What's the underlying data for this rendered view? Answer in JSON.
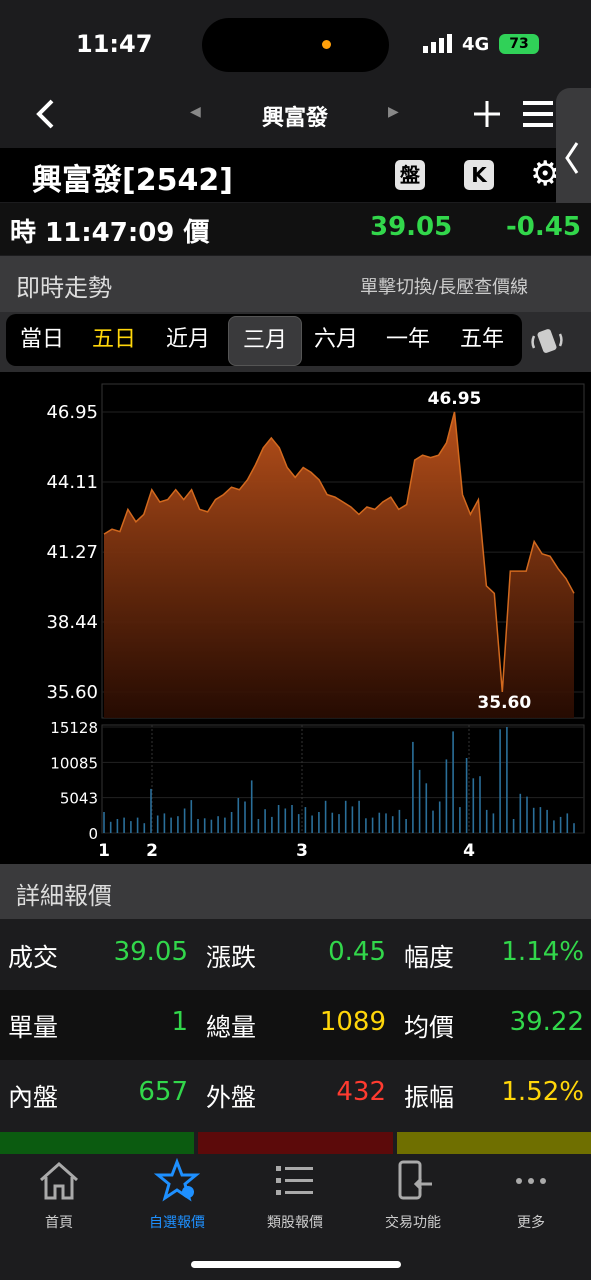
{
  "status_bar": {
    "time": "11:47",
    "network": "4G",
    "battery": "73",
    "colors": {
      "dot": "#ff9f0a",
      "battery": "#30d158"
    }
  },
  "nav": {
    "title": "興富發",
    "prev_icon": "triangle-left-icon",
    "next_icon": "triangle-right-icon",
    "back_icon": "chevron-left-icon",
    "plus_icon": "plus-icon",
    "menu_icon": "hamburger-icon",
    "side_icon": "chevron-left-icon"
  },
  "stock": {
    "title": "興富發[2542]",
    "pan_label": "盤",
    "k_label": "K",
    "gear_icon": "gear-icon"
  },
  "quote": {
    "time_label": "時 11:47:09 價",
    "price": "39.05",
    "change": "-0.45",
    "colors": {
      "up": "#32d74b"
    }
  },
  "trend": {
    "title": "即時走勢",
    "hint": "單擊切換/長壓查價線",
    "periods": [
      "當日",
      "五日",
      "近月",
      "三月",
      "六月",
      "一年",
      "五年"
    ],
    "active_period": "三月",
    "highlight_period": "五日"
  },
  "chart_data": [
    {
      "type": "area",
      "y_ticks": [
        "46.95",
        "44.11",
        "41.27",
        "38.44",
        "35.60"
      ],
      "ylim": [
        35.6,
        46.95
      ],
      "high_label": "46.95",
      "low_label": "35.60",
      "values": [
        42.0,
        42.2,
        42.1,
        43.0,
        42.5,
        42.8,
        43.8,
        43.3,
        43.4,
        43.8,
        43.4,
        43.8,
        43.0,
        42.9,
        43.4,
        43.6,
        43.9,
        43.8,
        44.2,
        44.8,
        45.5,
        45.9,
        45.5,
        44.7,
        44.3,
        44.7,
        44.5,
        44.2,
        43.6,
        43.5,
        43.3,
        43.1,
        42.8,
        43.1,
        43.0,
        43.3,
        43.5,
        43.0,
        43.2,
        45.0,
        45.2,
        45.1,
        45.2,
        45.7,
        46.95,
        43.6,
        42.8,
        43.4,
        39.9,
        39.6,
        35.6,
        40.5,
        40.5,
        40.5,
        41.7,
        41.2,
        41.1,
        40.6,
        40.2,
        39.6
      ]
    },
    {
      "type": "bar",
      "y_ticks": [
        "15128",
        "10085",
        "5043",
        "0"
      ],
      "ylim": [
        0,
        15128
      ],
      "x_labels": [
        "1",
        "2",
        "3",
        "4"
      ],
      "values": [
        3000,
        1600,
        2000,
        2200,
        1700,
        2200,
        1400,
        6300,
        2500,
        2800,
        2200,
        2400,
        3500,
        4700,
        2000,
        2100,
        1900,
        2400,
        2200,
        3000,
        5000,
        4500,
        7500,
        2000,
        3400,
        2300,
        4000,
        3500,
        4000,
        2700,
        3700,
        2500,
        3000,
        4600,
        2900,
        2700,
        4600,
        3800,
        4600,
        2100,
        2200,
        2900,
        2800,
        2400,
        3300,
        2000,
        13000,
        9000,
        7100,
        3200,
        4500,
        10500,
        14500,
        3700,
        10700,
        7800,
        8100,
        3300,
        2800,
        14800,
        15128,
        2000,
        5600,
        5200,
        3600,
        3700,
        3300,
        1800,
        2300,
        2800,
        1400
      ]
    }
  ],
  "details": {
    "title": "詳細報價",
    "rows": [
      [
        {
          "label": "成交",
          "value": "39.05",
          "color": "#32d74b"
        },
        {
          "label": "漲跌",
          "value": "0.45",
          "color": "#32d74b"
        },
        {
          "label": "幅度",
          "value": "1.14%",
          "color": "#32d74b"
        }
      ],
      [
        {
          "label": "單量",
          "value": "1",
          "color": "#32d74b"
        },
        {
          "label": "總量",
          "value": "1089",
          "color": "#ffd60a"
        },
        {
          "label": "均價",
          "value": "39.22",
          "color": "#32d74b"
        }
      ],
      [
        {
          "label": "內盤",
          "value": "657",
          "color": "#32d74b"
        },
        {
          "label": "外盤",
          "value": "432",
          "color": "#ff3b30"
        },
        {
          "label": "振幅",
          "value": "1.52%",
          "color": "#ffd60a"
        }
      ]
    ],
    "bar_colors": [
      "#0b5b10",
      "#5c0a0a",
      "#6f6f00"
    ]
  },
  "tabbar": {
    "items": [
      {
        "label": "首頁",
        "icon": "home-icon",
        "active": false
      },
      {
        "label": "自選報價",
        "icon": "star-icon",
        "active": true
      },
      {
        "label": "類股報價",
        "icon": "list-icon",
        "active": false
      },
      {
        "label": "交易功能",
        "icon": "phone-trade-icon",
        "active": false
      },
      {
        "label": "更多",
        "icon": "more-dots-icon",
        "active": false
      }
    ],
    "active_color": "#1e90ff"
  }
}
